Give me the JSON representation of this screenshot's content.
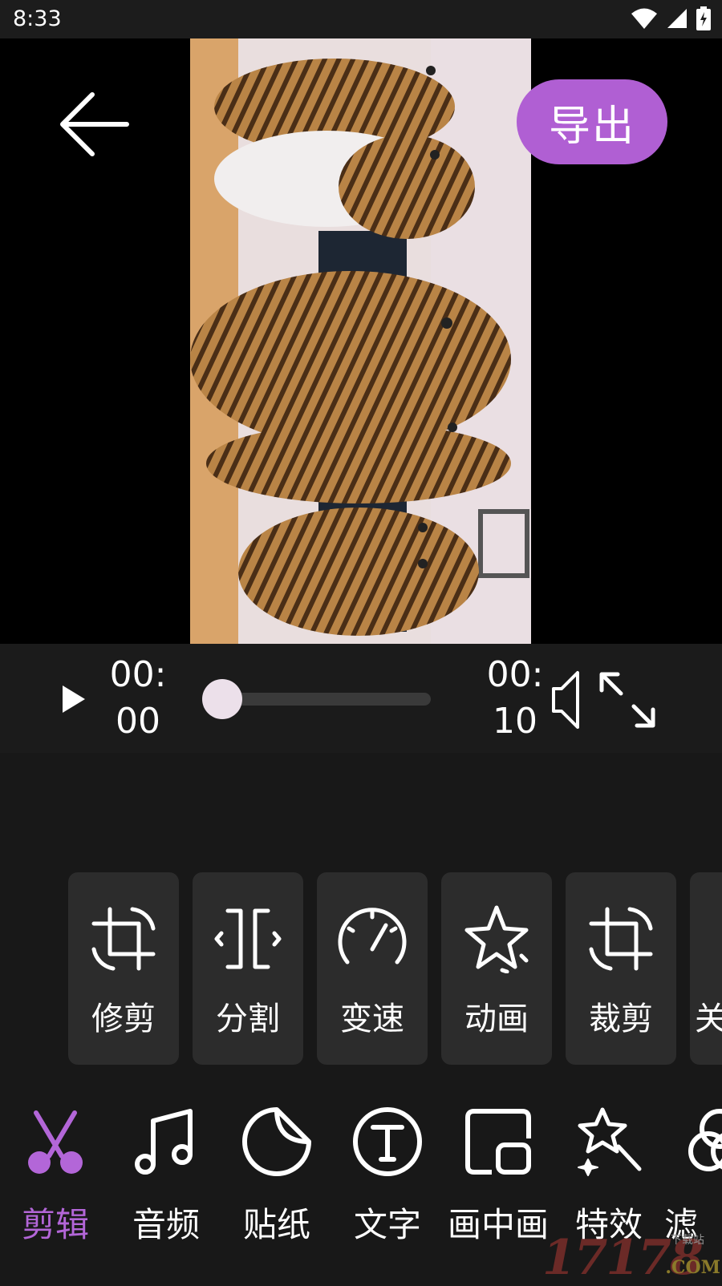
{
  "status_bar": {
    "time": "8:33"
  },
  "header": {
    "export_label": "导出"
  },
  "player": {
    "current_time": "00:\n00",
    "total_time": "00:\n10",
    "progress": 0.0
  },
  "tools": [
    {
      "label": "修剪",
      "icon": "trim-icon"
    },
    {
      "label": "分割",
      "icon": "split-icon"
    },
    {
      "label": "变速",
      "icon": "speed-icon"
    },
    {
      "label": "动画",
      "icon": "animation-icon"
    },
    {
      "label": "裁剪",
      "icon": "crop-icon"
    },
    {
      "label": "关",
      "icon": "partial-icon"
    }
  ],
  "nav": [
    {
      "label": "剪辑",
      "icon": "scissors-icon",
      "active": true
    },
    {
      "label": "音频",
      "icon": "music-note-icon"
    },
    {
      "label": "贴纸",
      "icon": "sticker-icon"
    },
    {
      "label": "文字",
      "icon": "text-icon"
    },
    {
      "label": "画中画",
      "icon": "picture-in-picture-icon"
    },
    {
      "label": "特效",
      "icon": "effects-icon"
    },
    {
      "label": "滤",
      "icon": "filter-icon"
    }
  ],
  "watermark": {
    "number": "17178",
    "domain": ".COM",
    "small": "下载站"
  },
  "colors": {
    "accent": "#b05fd3",
    "active_nav": "#b366d8",
    "card_bg": "#2c2c2c"
  }
}
